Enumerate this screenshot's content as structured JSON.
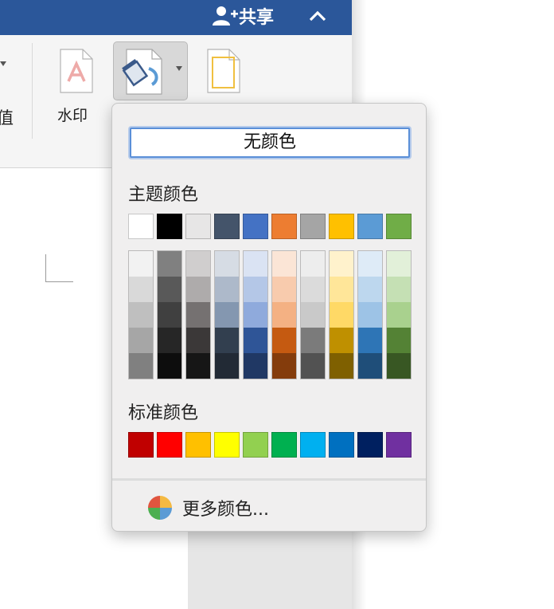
{
  "titlebar": {
    "share_label": "共享",
    "color": "#2b579a"
  },
  "ribbon": {
    "cut_label": "值",
    "watermark_label": "水印",
    "icons": [
      "watermark-icon",
      "paint-bucket-icon",
      "page-border-icon"
    ]
  },
  "popup": {
    "no_color_label": "无颜色",
    "theme_title": "主题颜色",
    "standard_title": "标准颜色",
    "more_colors_label": "更多颜色...",
    "theme_colors": [
      "#ffffff",
      "#000000",
      "#e7e6e6",
      "#44546a",
      "#4472c4",
      "#ed7d31",
      "#a5a5a5",
      "#ffc000",
      "#5b9bd5",
      "#70ad47"
    ],
    "theme_shades": [
      [
        "#f2f2f2",
        "#d9d9d9",
        "#bfbfbf",
        "#a6a6a6",
        "#808080"
      ],
      [
        "#808080",
        "#595959",
        "#404040",
        "#262626",
        "#0d0d0d"
      ],
      [
        "#d0cece",
        "#aeabab",
        "#757171",
        "#3b3838",
        "#161616"
      ],
      [
        "#d6dce4",
        "#adb9ca",
        "#8497b0",
        "#323f4f",
        "#222a35"
      ],
      [
        "#dae3f3",
        "#b4c7e7",
        "#8faadc",
        "#2f5597",
        "#203864"
      ],
      [
        "#fbe5d6",
        "#f8cbad",
        "#f4b183",
        "#c55a11",
        "#843c0c"
      ],
      [
        "#ededed",
        "#dbdbdb",
        "#c9c9c9",
        "#7b7b7b",
        "#525252"
      ],
      [
        "#fff2cc",
        "#ffe699",
        "#ffd966",
        "#bf9000",
        "#7f6000"
      ],
      [
        "#deebf7",
        "#bdd7ee",
        "#9dc3e6",
        "#2e75b6",
        "#1f4e79"
      ],
      [
        "#e2f0d9",
        "#c5e0b4",
        "#a9d18e",
        "#548235",
        "#385723"
      ]
    ],
    "standard_colors": [
      "#c00000",
      "#ff0000",
      "#ffc000",
      "#ffff00",
      "#92d050",
      "#00b050",
      "#00b0f0",
      "#0070c0",
      "#002060",
      "#7030a0"
    ]
  }
}
